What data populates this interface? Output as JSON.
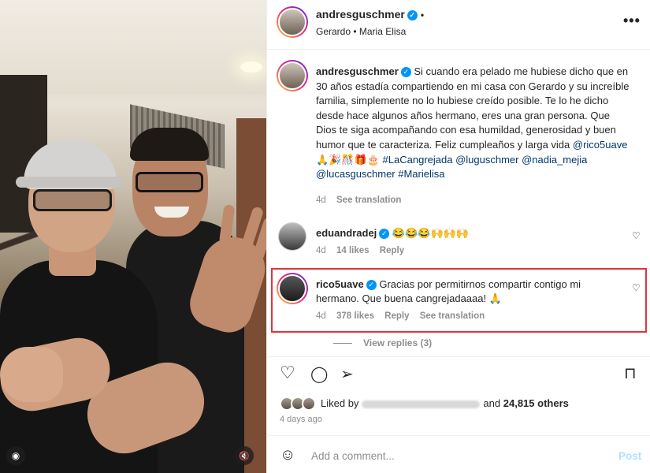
{
  "post": {
    "author": "andresguschmer",
    "tagged": "Gerardo • Maria Elisa",
    "more": "•••",
    "dot": "•"
  },
  "caption": {
    "author": "andresguschmer",
    "text": "Si cuando era pelado me hubiese dicho que en 30 años estadía compartiendo en mi casa con Gerardo y su increíble familia, simplemente no lo hubiese creído posible. Te lo he dicho desde hace algunos años hermano, eres una gran persona. Que Dios te siga acompañando con esa humildad, generosidad y buen humor que te caracteriza. Feliz cumpleaños y larga vida ",
    "mention1": "@rico5uave",
    "emojis": " 🙏🎉🎊🎁🎂 ",
    "tags": "#LaCangrejada @luguschmer @nadia_mejia @lucasguschmer #Marielisa",
    "time": "4d",
    "see_translation": "See translation"
  },
  "comments": [
    {
      "user": "eduandradej",
      "text": "😂😂😂🙌🙌🙌",
      "time": "4d",
      "likes": "14 likes",
      "reply": "Reply"
    },
    {
      "user": "rico5uave",
      "text": "Gracias por permitirnos compartir contigo mi hermano. Que buena cangrejadaaaa! 🙏",
      "time": "4d",
      "likes": "378 likes",
      "reply": "Reply",
      "see_translation": "See translation"
    }
  ],
  "view_replies": "View replies (3)",
  "likes": {
    "prefix": "Liked by",
    "suffix": "and",
    "count": "24,815 others"
  },
  "posted": "4 days ago",
  "composer": {
    "placeholder": "Add a comment...",
    "post_label": "Post"
  },
  "icons": {
    "heart": "♡",
    "comment": "◯",
    "share": "➢",
    "bookmark": "⊓",
    "emoji": "☺",
    "reel": "◉",
    "mute": "🔇"
  },
  "colors": {
    "link": "#00376b",
    "verified": "#0095f6",
    "highlight_box": "#e0343a",
    "muted": "#8e8e8e"
  }
}
